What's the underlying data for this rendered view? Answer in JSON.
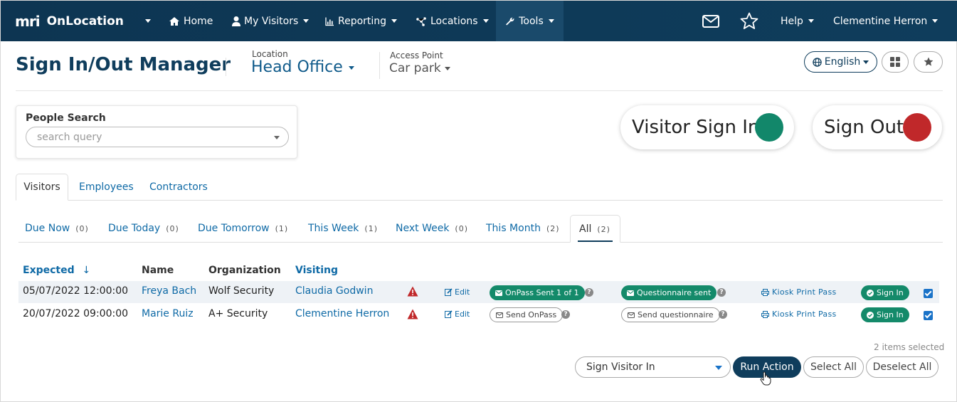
{
  "nav": {
    "brand_mark": "mri",
    "brand_name": "OnLocation",
    "items": [
      {
        "label": "Home",
        "icon": "home-icon"
      },
      {
        "label": "My Visitors",
        "icon": "person-icon"
      },
      {
        "label": "Reporting",
        "icon": "bar-chart-icon"
      },
      {
        "label": "Locations",
        "icon": "network-icon"
      },
      {
        "label": "Tools",
        "icon": "wrench-icon"
      }
    ],
    "help_label": "Help",
    "user_name": "Clementine Herron"
  },
  "header": {
    "title": "Sign In/Out Manager",
    "location_label": "Location",
    "location_value": "Head Office",
    "access_point_label": "Access Point",
    "access_point_value": "Car park",
    "language": "English"
  },
  "people_search": {
    "label": "People Search",
    "placeholder": "search query"
  },
  "actions": {
    "visitor_sign_in": "Visitor Sign In",
    "sign_out": "Sign Out",
    "sign_in_color": "#12876a",
    "sign_out_color": "#c0282a"
  },
  "people_tabs": [
    "Visitors",
    "Employees",
    "Contractors"
  ],
  "filter_tabs": [
    {
      "label": "Due Now",
      "count": "(0)"
    },
    {
      "label": "Due Today",
      "count": "(0)"
    },
    {
      "label": "Due Tomorrow",
      "count": "(1)"
    },
    {
      "label": "This Week",
      "count": "(1)"
    },
    {
      "label": "Next Week",
      "count": "(0)"
    },
    {
      "label": "This Month",
      "count": "(2)"
    },
    {
      "label": "All",
      "count": "(2)"
    }
  ],
  "table": {
    "headers": {
      "expected": "Expected",
      "sort_indicator": "↓",
      "name": "Name",
      "organization": "Organization",
      "visiting": "Visiting"
    },
    "rows": [
      {
        "expected": "05/07/2022 12:00:00",
        "name": "Freya Bach",
        "organization": "Wolf Security",
        "visiting": "Claudia Godwin",
        "edit": "Edit",
        "onpass": "OnPass Sent 1 of 1",
        "questionnaire": "Questionnaire sent",
        "kiosk": "Kiosk Print Pass",
        "sign_in": "Sign In"
      },
      {
        "expected": "20/07/2022 09:00:00",
        "name": "Marie Ruiz",
        "organization": "A+ Security",
        "visiting": "Clementine Herron",
        "edit": "Edit",
        "onpass": "Send OnPass",
        "questionnaire": "Send questionnaire",
        "kiosk": "Kiosk Print Pass",
        "sign_in": "Sign In"
      }
    ]
  },
  "footer": {
    "selected_count": "2 items selected",
    "action_select": "Sign Visitor In",
    "run_action": "Run Action",
    "select_all": "Select All",
    "deselect_all": "Deselect All"
  }
}
